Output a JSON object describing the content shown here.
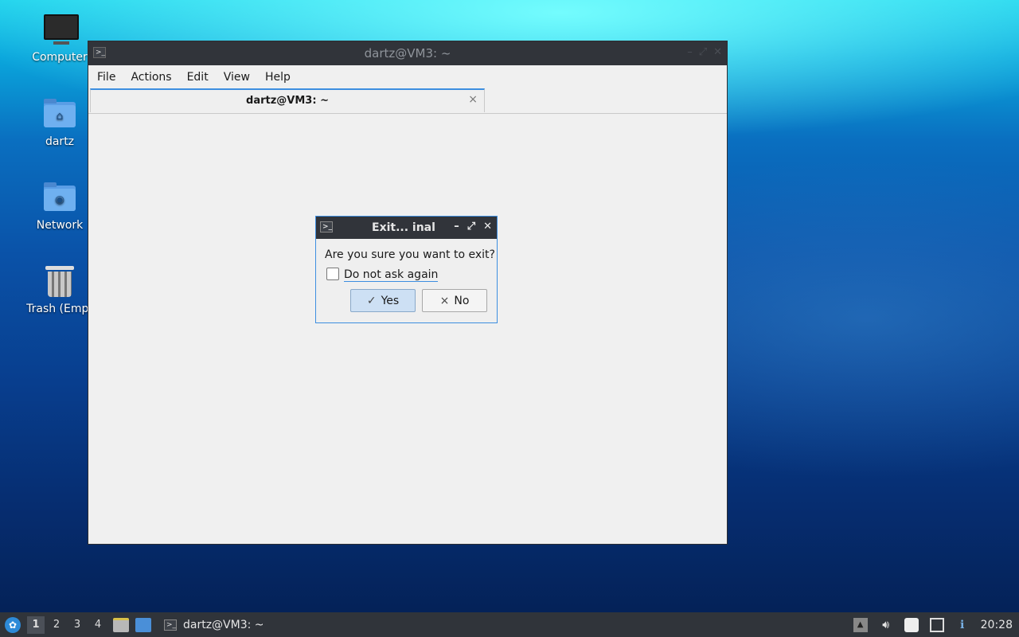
{
  "desktop": {
    "icons": [
      {
        "label": "Computer",
        "icon": "monitor-icon"
      },
      {
        "label": "dartz",
        "icon": "home-folder-icon"
      },
      {
        "label": "Network",
        "icon": "network-folder-icon"
      },
      {
        "label": "Trash (Empt",
        "icon": "trash-icon"
      }
    ]
  },
  "terminal": {
    "title": "dartz@VM3: ~",
    "menu": [
      "File",
      "Actions",
      "Edit",
      "View",
      "Help"
    ],
    "tab_label": "dartz@VM3: ~",
    "tab_close": "×"
  },
  "dialog": {
    "title": "Exit... inal",
    "message": "Are you sure you want to exit?",
    "checkbox_label": "Do not ask again",
    "checkbox_checked": false,
    "yes_label": "Yes",
    "no_label": "No",
    "yes_glyph": "✓",
    "no_glyph": "×"
  },
  "taskbar": {
    "workspaces": [
      "1",
      "2",
      "3",
      "4"
    ],
    "active_workspace": "1",
    "task_label": "dartz@VM3: ~",
    "clock": "20:28"
  }
}
